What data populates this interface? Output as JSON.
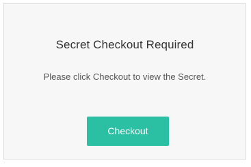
{
  "dialog": {
    "title": "Secret Checkout Required",
    "message": "Please click Checkout to view the Secret.",
    "checkout_label": "Checkout"
  },
  "colors": {
    "accent": "#2bc0a4",
    "panel_background": "#f7f7f7",
    "border": "#dcdcdc"
  }
}
